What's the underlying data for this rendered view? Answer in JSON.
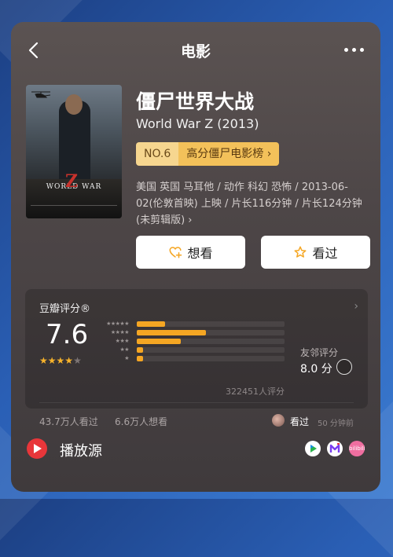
{
  "header": {
    "title": "电影"
  },
  "movie": {
    "title": "僵尸世界大战",
    "subtitle": "World War Z (2013)",
    "rank_no": "NO.6",
    "rank_list": "高分僵尸电影榜 ›",
    "meta": "美国 英国 马耳他 / 动作 科幻 恐怖 / 2013-06-02(伦敦首映) 上映 / 片长116分钟 / 片长124分钟 (未剪辑版) ›",
    "poster_title": "WORLD WAR",
    "poster_z": "Z"
  },
  "actions": {
    "want": "想看",
    "seen": "看过"
  },
  "rating": {
    "label": "豆瓣评分®",
    "score": "7.6",
    "stars_filled": 4,
    "stars_total": 5,
    "distribution": [
      {
        "stars": "★★★★★",
        "percent": 19
      },
      {
        "stars": "★★★★",
        "percent": 47
      },
      {
        "stars": "★★★",
        "percent": 30
      },
      {
        "stars": "★★",
        "percent": 4
      },
      {
        "stars": "★",
        "percent": 4
      }
    ],
    "count": "322451人评分",
    "friend_label": "友邻评分",
    "friend_score": "8.0 分",
    "watched": "43.7万人看过",
    "wish": "6.6万人想看",
    "recent_text": "看过",
    "recent_time": "50 分钟前"
  },
  "source": {
    "label": "播放源",
    "bili_text": "bilibili"
  }
}
